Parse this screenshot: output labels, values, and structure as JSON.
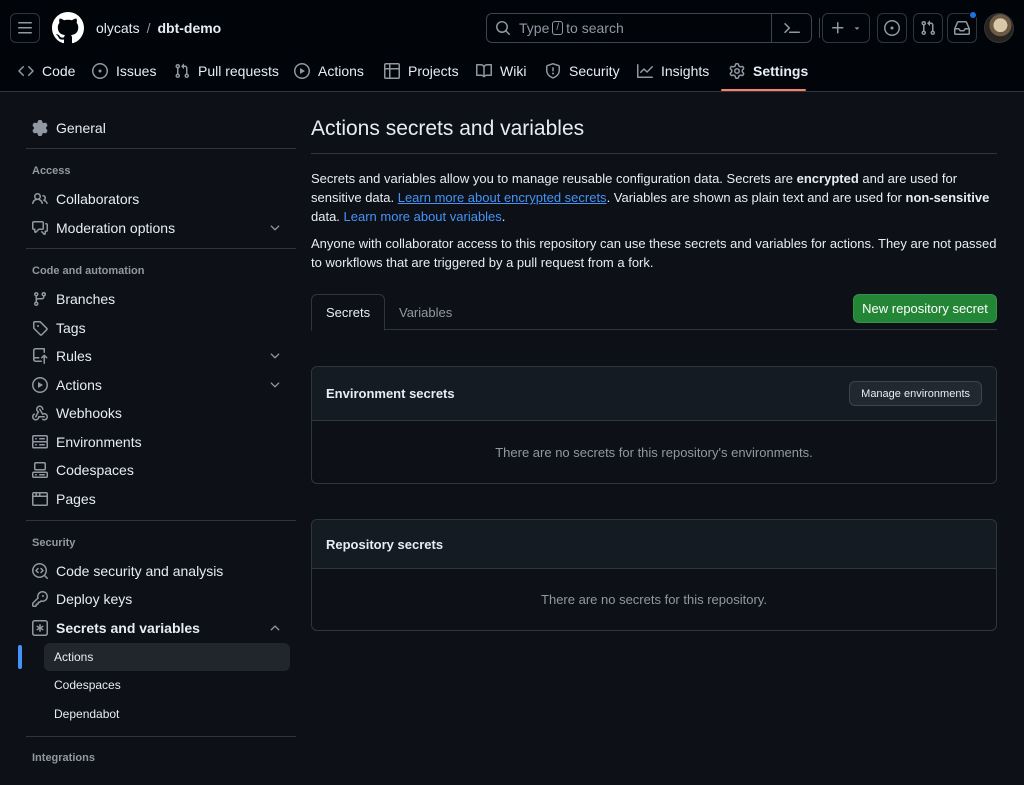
{
  "header": {
    "owner": "olycats",
    "separator": "/",
    "repo": "dbt-demo",
    "search": {
      "prefix": "Type",
      "key": "/",
      "suffix": "to search"
    }
  },
  "repo_nav": {
    "tabs": [
      {
        "label": "Code",
        "icon": "code-icon"
      },
      {
        "label": "Issues",
        "icon": "issue-opened-icon"
      },
      {
        "label": "Pull requests",
        "icon": "git-pull-request-icon"
      },
      {
        "label": "Actions",
        "icon": "play-icon"
      },
      {
        "label": "Projects",
        "icon": "table-icon"
      },
      {
        "label": "Wiki",
        "icon": "book-icon"
      },
      {
        "label": "Security",
        "icon": "shield-icon"
      },
      {
        "label": "Insights",
        "icon": "graph-icon"
      },
      {
        "label": "Settings",
        "icon": "gear-icon",
        "selected": true
      }
    ]
  },
  "sidebar": {
    "general": "General",
    "access_heading": "Access",
    "collaborators": "Collaborators",
    "moderation": "Moderation options",
    "code_heading": "Code and automation",
    "branches": "Branches",
    "tags": "Tags",
    "rules": "Rules",
    "actions": "Actions",
    "webhooks": "Webhooks",
    "environments": "Environments",
    "codespaces": "Codespaces",
    "pages": "Pages",
    "security_heading": "Security",
    "code_security": "Code security and analysis",
    "deploy_keys": "Deploy keys",
    "secrets_variables": "Secrets and variables",
    "sub_actions": "Actions",
    "sub_codespaces": "Codespaces",
    "sub_dependabot": "Dependabot",
    "integrations_heading": "Integrations"
  },
  "main": {
    "title": "Actions secrets and variables",
    "desc1": {
      "part1": "Secrets and variables allow you to manage reusable configuration data. Secrets are ",
      "bold1": "encrypted",
      "part2": " and are used for sensitive data. ",
      "link1": "Learn more about encrypted secrets",
      "part3": ". Variables are shown as plain text and are used for ",
      "bold2": "non-sensitive",
      "part4": " data. ",
      "link2": "Learn more about variables",
      "part5": "."
    },
    "desc2": "Anyone with collaborator access to this repository can use these secrets and variables for actions. They are not passed to workflows that are triggered by a pull request from a fork.",
    "tabs": {
      "secrets": "Secrets",
      "variables": "Variables"
    },
    "new_secret_button": "New repository secret",
    "env_box": {
      "title": "Environment secrets",
      "button": "Manage environments",
      "empty": "There are no secrets for this repository's environments."
    },
    "repo_box": {
      "title": "Repository secrets",
      "empty": "There are no secrets for this repository."
    }
  },
  "colors": {
    "background": "#0d1117",
    "header_bg": "#010409",
    "accent_underline": "#f78166",
    "primary_button": "#238636",
    "link": "#4493f8",
    "active_indicator": "#4493f8",
    "notification_dot": "#1f6feb"
  }
}
